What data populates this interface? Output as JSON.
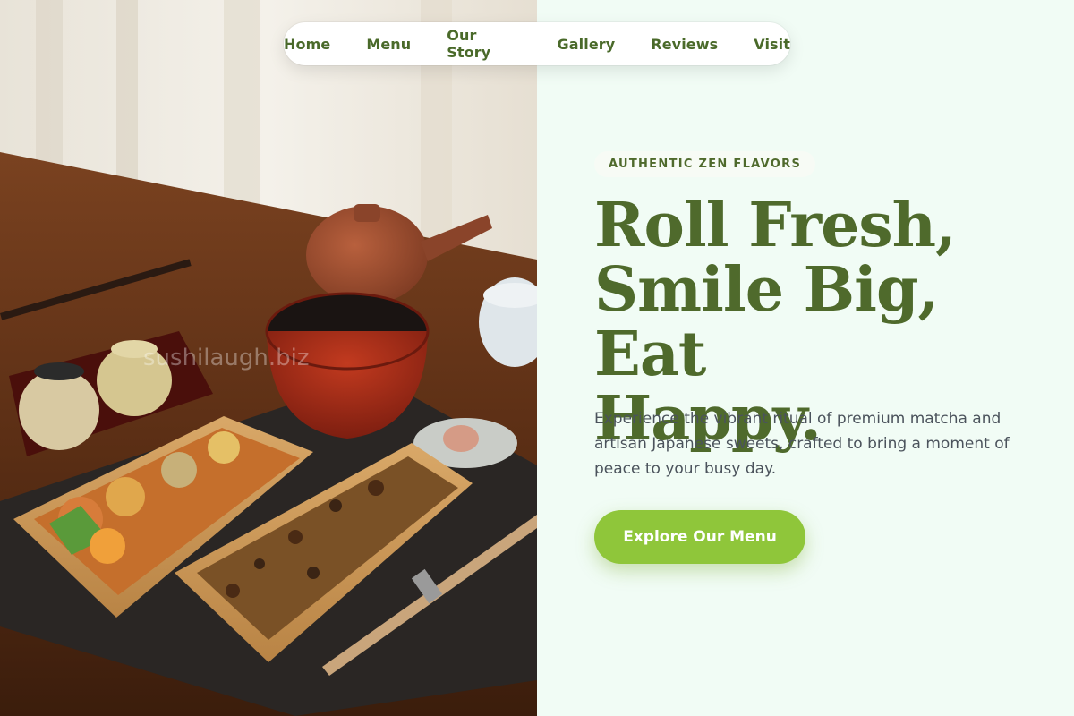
{
  "nav": {
    "items": [
      "Home",
      "Menu",
      "Our Story",
      "Gallery",
      "Reviews",
      "Visit"
    ]
  },
  "hero": {
    "eyebrow": "AUTHENTIC ZEN FLAVORS",
    "headline_line1": "Roll Fresh,",
    "headline_line2": "Smile Big, Eat",
    "headline_line3": "Happy.",
    "lede": "Experience the vibrant ritual of premium matcha and artisan Japanese sweets, crafted to bring a moment of peace to your busy day.",
    "cta_label": "Explore Our Menu"
  },
  "photo": {
    "watermark": "sushilaugh.biz"
  },
  "colors": {
    "brand_green": "#4f6a2c",
    "cta_green": "#8fc63a",
    "panel_bg": "#f1fcf5"
  }
}
